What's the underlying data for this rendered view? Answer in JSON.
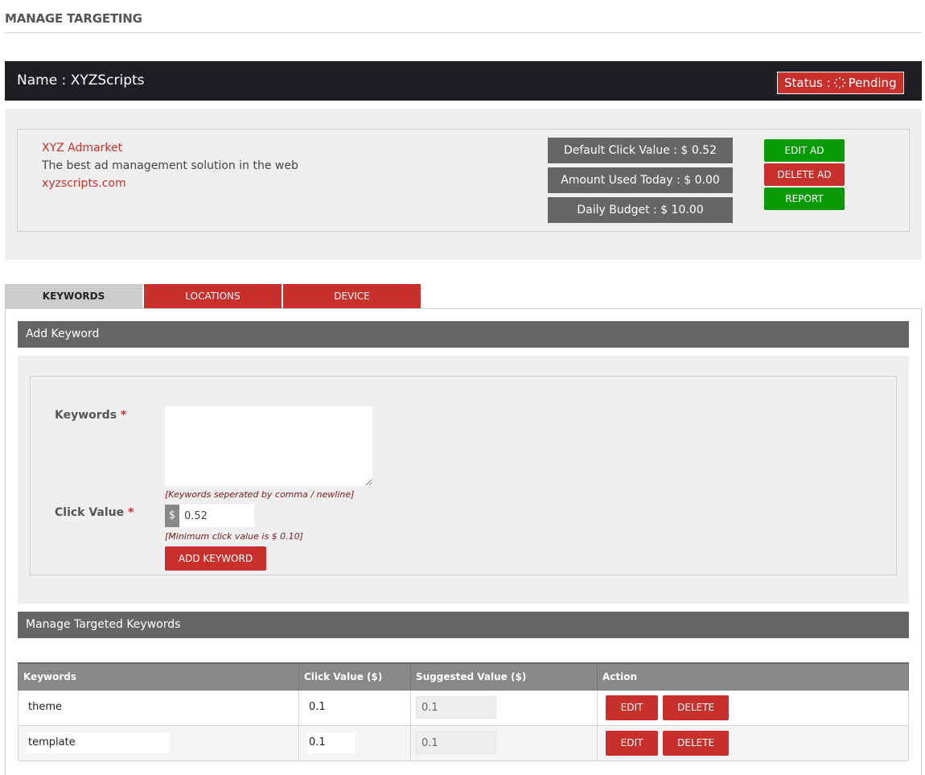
{
  "page": {
    "title": "MANAGE TARGETING"
  },
  "ad_header": {
    "name_label": "Name : XYZScripts",
    "status_prefix": "Status :",
    "status_icon": "spinner-icon",
    "status_value": "Pending"
  },
  "ad_details": {
    "title": "XYZ Admarket",
    "description": "The best ad management solution in the web",
    "url": "xyzscripts.com",
    "stats": {
      "default_click_value": "Default Click Value : $ 0.52",
      "amount_used_today": "Amount Used Today : $ 0.00",
      "daily_budget": "Daily Budget : $ 10.00"
    },
    "buttons": {
      "edit": "EDIT AD",
      "delete": "DELETE AD",
      "report": "REPORT"
    }
  },
  "tabs": [
    {
      "label": "KEYWORDS",
      "active": true
    },
    {
      "label": "LOCATIONS",
      "active": false
    },
    {
      "label": "DEVICE",
      "active": false
    }
  ],
  "add_keyword": {
    "header": "Add Keyword",
    "keywords_label": "Keywords",
    "required_mark": "*",
    "keywords_value": "",
    "keywords_hint": "[Keywords seperated by comma / newline]",
    "click_value_label": "Click Value",
    "currency_symbol": "$",
    "click_value": "0.52",
    "click_value_hint": "[Minimum click value is $ 0.10]",
    "submit_label": "ADD KEYWORD"
  },
  "manage_keywords": {
    "header": "Manage Targeted Keywords",
    "columns": [
      "Keywords",
      "Click Value ($)",
      "Suggested Value ($)",
      "Action"
    ],
    "rows": [
      {
        "keyword": "theme",
        "click_value": "0.1",
        "suggested_value": "0.1",
        "edit": "EDIT",
        "delete": "DELETE"
      },
      {
        "keyword": "template",
        "click_value": "0.1",
        "suggested_value": "0.1",
        "edit": "EDIT",
        "delete": "DELETE"
      }
    ]
  },
  "colors": {
    "brand_red": "#c9302c",
    "success_green": "#079c07",
    "dark_bar": "#1e1f23",
    "section_gray": "#666666"
  }
}
